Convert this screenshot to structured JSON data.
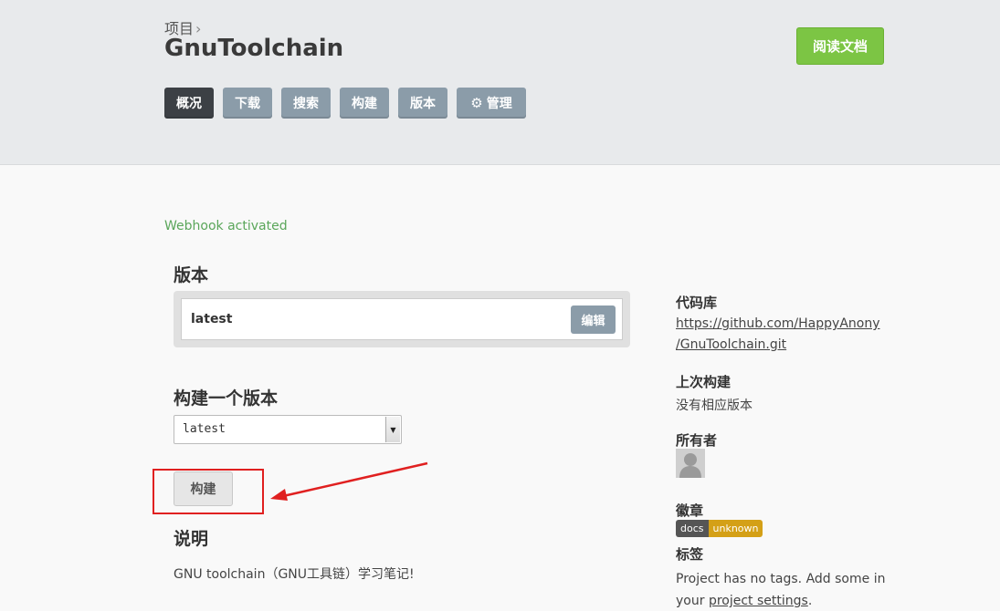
{
  "header": {
    "breadcrumb": "项目",
    "breadcrumb_sep": "›",
    "title": "GnuToolchain",
    "read_docs": "阅读文档",
    "tabs": [
      {
        "label": "概况",
        "active": true
      },
      {
        "label": "下载"
      },
      {
        "label": "搜索"
      },
      {
        "label": "构建"
      },
      {
        "label": "版本"
      },
      {
        "label": "管理",
        "icon": "gear-icon"
      }
    ]
  },
  "notice": "Webhook activated",
  "versions": {
    "heading": "版本",
    "items": [
      {
        "name": "latest",
        "edit_label": "编辑"
      }
    ]
  },
  "build": {
    "heading": "构建一个版本",
    "selected": "latest",
    "button": "构建"
  },
  "description": {
    "heading": "说明",
    "text": "GNU toolchain（GNU工具链）学习笔记!"
  },
  "sidebar": {
    "repo_heading": "代码库",
    "repo_line1": "https://github.com/HappyAnony",
    "repo_line2": "/GnuToolchain.git",
    "last_build_heading": "上次构建",
    "last_build_text": "没有相应版本",
    "owner_heading": "所有者",
    "badge_heading": "徽章",
    "badge_left": "docs",
    "badge_right": "unknown",
    "tags_heading": "标签",
    "tags_line1": "Project has no tags. Add some in",
    "tags_line2_prefix": "your",
    "tags_link": "project settings",
    "tags_suffix": "."
  },
  "colors": {
    "accent_green": "#7cc544",
    "tab_gray": "#8b9ca9",
    "tab_active": "#3c4045",
    "badge_unknown": "#d4a017",
    "annotation_red": "#e02020"
  }
}
